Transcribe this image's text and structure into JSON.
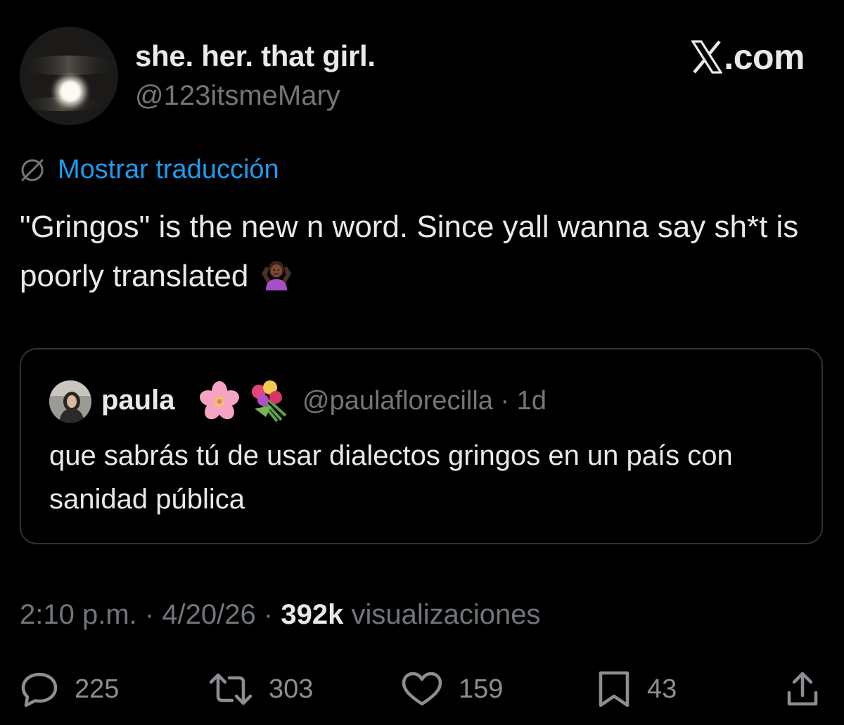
{
  "author": {
    "display_name": "she. her. that girl.",
    "handle": "@123itsmeMary",
    "avatar_icon": "moon-avatar"
  },
  "brand": {
    "label": ".com",
    "logo_icon": "x-logo-icon"
  },
  "translate": {
    "icon": "globe-icon",
    "label": "Mostrar traducción"
  },
  "tweet": {
    "text": "\"Gringos\" is the new n word. Since yall wanna say sh*t is poorly translated",
    "emoji": "person-shrugging-emoji"
  },
  "quote": {
    "name": "paula",
    "emojis": [
      "cherry-blossom-emoji",
      "bouquet-emoji"
    ],
    "handle": "@paulaflorecilla",
    "separator": " · ",
    "age": "1d",
    "text": "que sabrás tú de usar dialectos gringos en un país con sanidad pública"
  },
  "meta": {
    "time": "2:10 p.m.",
    "separator": " · ",
    "date": "4/20/26",
    "views_count": "392k",
    "views_label": "visualizaciones"
  },
  "actions": {
    "replies": "225",
    "reposts": "303",
    "likes": "159",
    "bookmarks": "43"
  },
  "colors": {
    "background": "#000000",
    "text_primary": "#e7e9ea",
    "text_secondary": "#71767b",
    "link": "#1d9bf0",
    "border": "#2f3336"
  }
}
